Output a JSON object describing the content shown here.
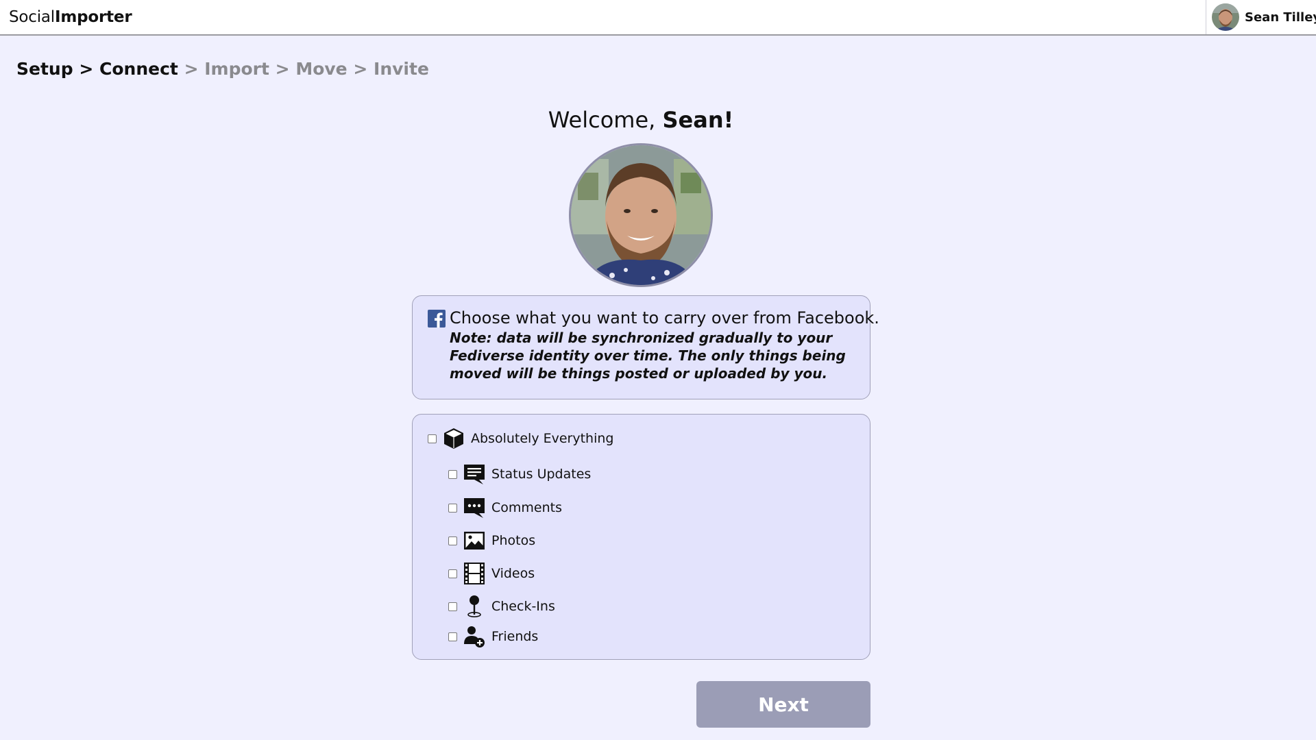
{
  "header": {
    "brand_part1": "Social",
    "brand_part2": "Importer",
    "user_name": "Sean Tilley"
  },
  "breadcrumb": {
    "steps": [
      {
        "label": "Setup",
        "state": "done"
      },
      {
        "label": "Connect",
        "state": "done"
      },
      {
        "label": "Import",
        "state": "todo"
      },
      {
        "label": "Move",
        "state": "todo"
      },
      {
        "label": "Invite",
        "state": "todo"
      }
    ],
    "separator": ">"
  },
  "welcome": {
    "greeting": "Welcome,",
    "name": "Sean!"
  },
  "info": {
    "title": "Choose what you want to carry over from Facebook.",
    "note": "Note: data will be synchronized gradually to your Fediverse identity over time. The only things being moved will be things posted or uploaded by you."
  },
  "options": {
    "all": {
      "label": "Absolutely Everything",
      "icon": "cube-icon",
      "checked": false
    },
    "items": [
      {
        "label": "Status Updates",
        "icon": "status-update-icon",
        "checked": false
      },
      {
        "label": "Comments",
        "icon": "comments-icon",
        "checked": false
      },
      {
        "label": "Photos",
        "icon": "photo-icon",
        "checked": false
      },
      {
        "label": "Videos",
        "icon": "film-icon",
        "checked": false
      },
      {
        "label": "Check-Ins",
        "icon": "map-pin-icon",
        "checked": false
      },
      {
        "label": "Friends",
        "icon": "add-friend-icon",
        "checked": false
      }
    ]
  },
  "next_button": {
    "label": "Next",
    "enabled": false
  },
  "colors": {
    "page_bg": "#f0f0fe",
    "card_bg": "#e3e3fc",
    "next_bg": "#9b9db6",
    "facebook_blue": "#3b5998"
  }
}
